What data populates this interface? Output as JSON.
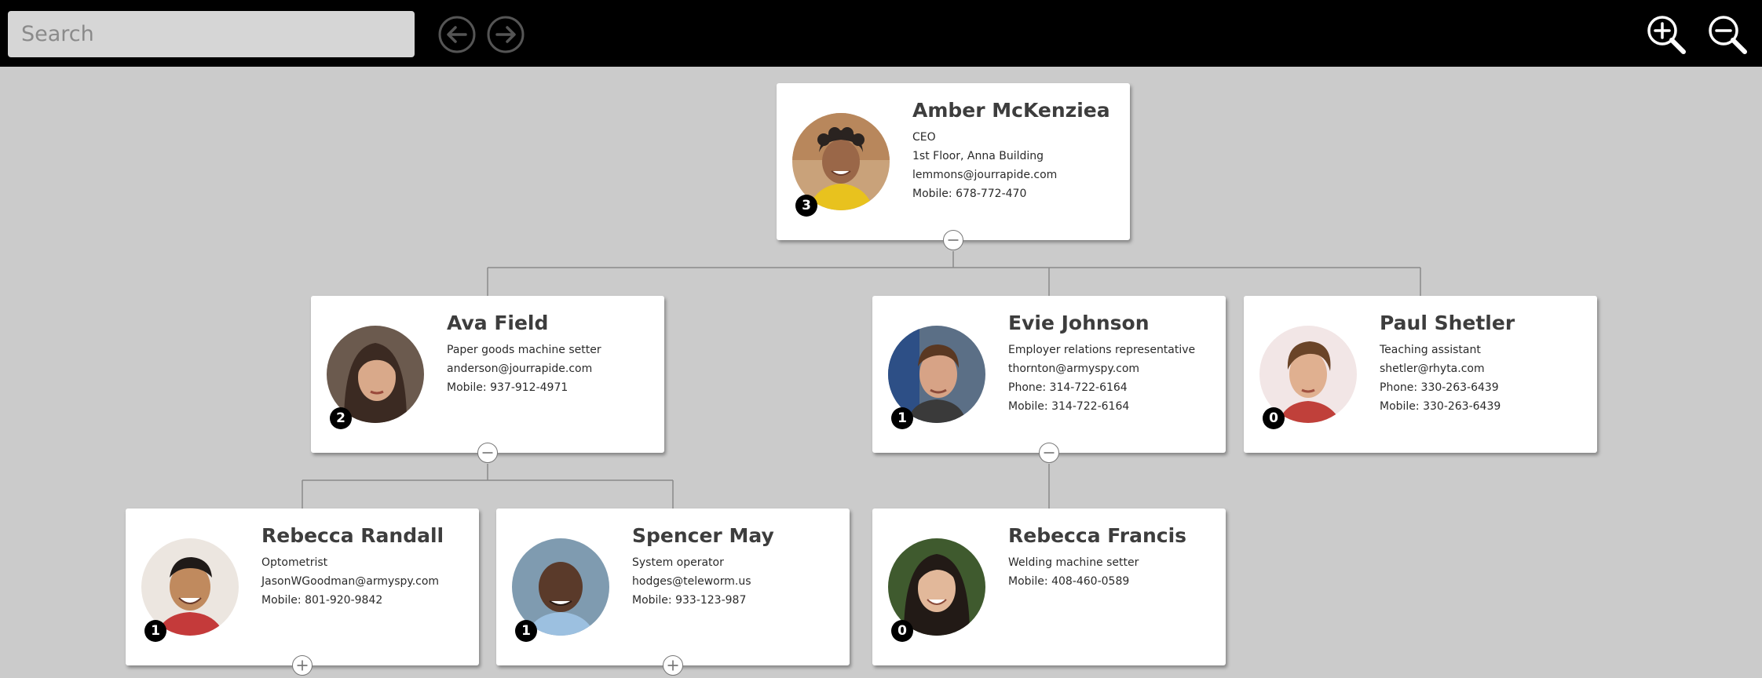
{
  "toolbar": {
    "search_placeholder": "Search",
    "back_icon": "arrow-left-circle-icon",
    "forward_icon": "arrow-right-circle-icon",
    "zoom_in_icon": "zoom-in-icon",
    "zoom_out_icon": "zoom-out-icon"
  },
  "colors": {
    "toolbar_bg": "#000000",
    "canvas_bg": "#cbcbcb",
    "card_bg": "#ffffff",
    "badge_bg": "#000000",
    "connector": "#8a8a8a"
  },
  "people": [
    {
      "name": "Amber McKenziea",
      "title": "CEO",
      "details": [
        "1st Floor, Anna Building",
        "lemmons@jourrapide.com",
        "Mobile: 678-772-470"
      ],
      "reports": "3",
      "toggle": "collapse-icon"
    },
    {
      "name": "Ava Field",
      "title": "Paper goods machine setter",
      "details": [
        "anderson@jourrapide.com",
        "Mobile: 937-912-4971"
      ],
      "reports": "2",
      "toggle": "collapse-icon"
    },
    {
      "name": "Evie Johnson",
      "title": "Employer relations representative",
      "details": [
        "thornton@armyspy.com",
        "Phone: 314-722-6164",
        "Mobile: 314-722-6164"
      ],
      "reports": "1",
      "toggle": "collapse-icon"
    },
    {
      "name": "Paul Shetler",
      "title": "Teaching assistant",
      "details": [
        "shetler@rhyta.com",
        "Phone: 330-263-6439",
        "Mobile: 330-263-6439"
      ],
      "reports": "0",
      "toggle": null
    },
    {
      "name": "Rebecca Randall",
      "title": "Optometrist",
      "details": [
        "JasonWGoodman@armyspy.com",
        "Mobile: 801-920-9842"
      ],
      "reports": "1",
      "toggle": "expand-icon"
    },
    {
      "name": "Spencer May",
      "title": "System operator",
      "details": [
        "hodges@teleworm.us",
        "Mobile: 933-123-987"
      ],
      "reports": "1",
      "toggle": "expand-icon"
    },
    {
      "name": "Rebecca Francis",
      "title": "Welding machine setter",
      "details": [
        "Mobile: 408-460-0589"
      ],
      "reports": "0",
      "toggle": null
    }
  ]
}
